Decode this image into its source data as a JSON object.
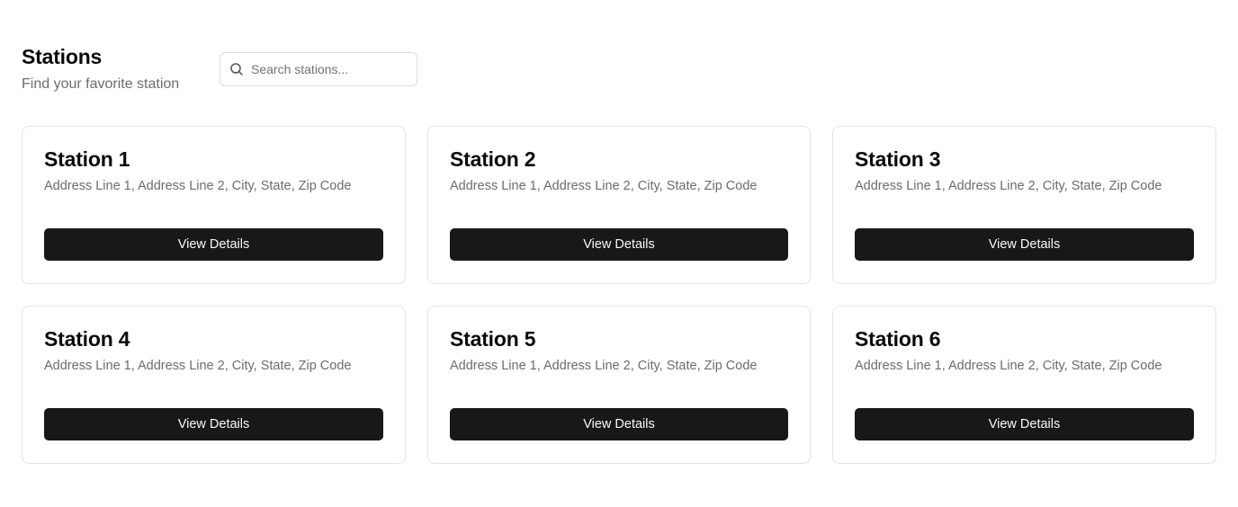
{
  "header": {
    "title": "Stations",
    "subtitle": "Find your favorite station"
  },
  "search": {
    "placeholder": "Search stations...",
    "value": "",
    "icon": "search-icon"
  },
  "colors": {
    "button_bg": "#18181b",
    "button_text": "#fafafa",
    "card_border": "#e4e4e7",
    "muted_text": "#6b6b73"
  },
  "stations": [
    {
      "name": "Station 1",
      "address": "Address Line 1, Address Line 2, City, State, Zip Code",
      "button_label": "View Details"
    },
    {
      "name": "Station 2",
      "address": "Address Line 1, Address Line 2, City, State, Zip Code",
      "button_label": "View Details"
    },
    {
      "name": "Station 3",
      "address": "Address Line 1, Address Line 2, City, State, Zip Code",
      "button_label": "View Details"
    },
    {
      "name": "Station 4",
      "address": "Address Line 1, Address Line 2, City, State, Zip Code",
      "button_label": "View Details"
    },
    {
      "name": "Station 5",
      "address": "Address Line 1, Address Line 2, City, State, Zip Code",
      "button_label": "View Details"
    },
    {
      "name": "Station 6",
      "address": "Address Line 1, Address Line 2, City, State, Zip Code",
      "button_label": "View Details"
    }
  ]
}
